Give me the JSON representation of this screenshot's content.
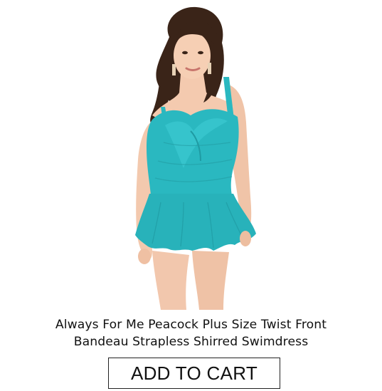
{
  "product": {
    "title_line1": "Always For Me Peacock Plus Size Twist Front",
    "title_line2": "Bandeau Strapless Shirred Swimdress",
    "image_subject": "model-in-peacock-swimdress",
    "swimdress_color": "#2ab8c0"
  },
  "actions": {
    "add_to_cart_label": "ADD TO CART"
  }
}
